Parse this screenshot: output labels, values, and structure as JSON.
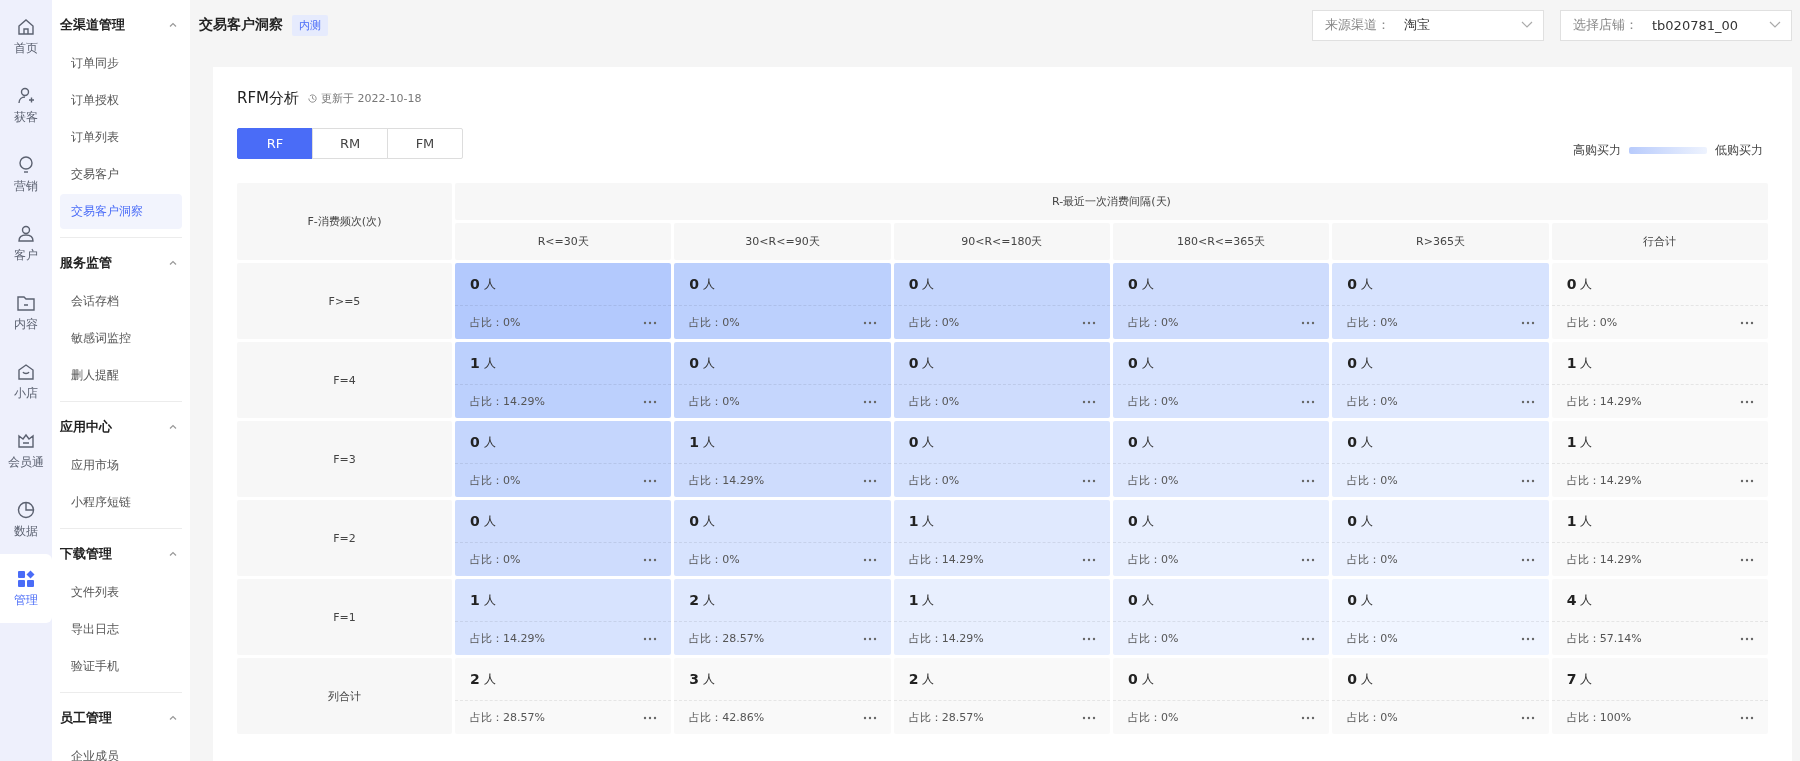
{
  "rail": [
    {
      "label": "首页",
      "selected": false
    },
    {
      "label": "获客",
      "selected": false
    },
    {
      "label": "营销",
      "selected": false
    },
    {
      "label": "客户",
      "selected": false
    },
    {
      "label": "内容",
      "selected": false
    },
    {
      "label": "小店",
      "selected": false
    },
    {
      "label": "会员通",
      "selected": false
    },
    {
      "label": "数据",
      "selected": false
    },
    {
      "label": "管理",
      "selected": true
    }
  ],
  "menu": [
    {
      "title": "全渠道管理",
      "expanded": true,
      "items": [
        {
          "label": "订单同步",
          "selected": false
        },
        {
          "label": "订单授权",
          "selected": false
        },
        {
          "label": "订单列表",
          "selected": false
        },
        {
          "label": "交易客户",
          "selected": false
        },
        {
          "label": "交易客户洞察",
          "selected": true
        }
      ]
    },
    {
      "title": "服务监管",
      "expanded": true,
      "items": [
        {
          "label": "会话存档",
          "selected": false
        },
        {
          "label": "敏感词监控",
          "selected": false
        },
        {
          "label": "删人提醒",
          "selected": false
        }
      ]
    },
    {
      "title": "应用中心",
      "expanded": true,
      "items": [
        {
          "label": "应用市场",
          "selected": false
        },
        {
          "label": "小程序短链",
          "selected": false
        }
      ]
    },
    {
      "title": "下载管理",
      "expanded": true,
      "items": [
        {
          "label": "文件列表",
          "selected": false
        },
        {
          "label": "导出日志",
          "selected": false
        },
        {
          "label": "验证手机",
          "selected": false
        }
      ]
    },
    {
      "title": "员工管理",
      "expanded": true,
      "items": [
        {
          "label": "企业成员",
          "selected": false
        }
      ]
    }
  ],
  "page": {
    "title": "交易客户洞察",
    "badge": "内测"
  },
  "filters": [
    {
      "label": "来源渠道：",
      "value": "淘宝"
    },
    {
      "label": "选择店铺：",
      "value": "tb020781_00"
    }
  ],
  "card": {
    "title": "RFM分析",
    "updated": "更新于 2022-10-18",
    "tabs": [
      {
        "label": "RF",
        "selected": true
      },
      {
        "label": "RM",
        "selected": false
      },
      {
        "label": "FM",
        "selected": false
      }
    ],
    "legend": {
      "high": "高购买力",
      "low": "低购买力"
    },
    "table": {
      "corner": "F-消费频次(次)",
      "group": "R-最近一次消费间隔(天)",
      "columns": [
        "R<=30天",
        "30<R<=90天",
        "90<R<=180天",
        "180<R<=365天",
        "R>365天",
        "行合计"
      ],
      "rows": [
        {
          "label": "F>=5",
          "cells": [
            {
              "count": "0",
              "unit": "人",
              "share": "占比：0%",
              "color": "#b3c9fd"
            },
            {
              "count": "0",
              "unit": "人",
              "share": "占比：0%",
              "color": "#bcd0fd"
            },
            {
              "count": "0",
              "unit": "人",
              "share": "占比：0%",
              "color": "#c5d6fd"
            },
            {
              "count": "0",
              "unit": "人",
              "share": "占比：0%",
              "color": "#cedcfd"
            },
            {
              "count": "0",
              "unit": "人",
              "share": "占比：0%",
              "color": "#d7e3fe"
            },
            {
              "count": "0",
              "unit": "人",
              "share": "占比：0%"
            }
          ]
        },
        {
          "label": "F=4",
          "cells": [
            {
              "count": "1",
              "unit": "人",
              "share": "占比：14.29%",
              "color": "#bcd0fd"
            },
            {
              "count": "0",
              "unit": "人",
              "share": "占比：0%",
              "color": "#c5d6fd"
            },
            {
              "count": "0",
              "unit": "人",
              "share": "占比：0%",
              "color": "#cedcfd"
            },
            {
              "count": "0",
              "unit": "人",
              "share": "占比：0%",
              "color": "#d7e3fe"
            },
            {
              "count": "0",
              "unit": "人",
              "share": "占比：0%",
              "color": "#e0e9fe"
            },
            {
              "count": "1",
              "unit": "人",
              "share": "占比：14.29%"
            }
          ]
        },
        {
          "label": "F=3",
          "cells": [
            {
              "count": "0",
              "unit": "人",
              "share": "占比：0%",
              "color": "#c5d6fd"
            },
            {
              "count": "1",
              "unit": "人",
              "share": "占比：14.29%",
              "color": "#cedcfd"
            },
            {
              "count": "0",
              "unit": "人",
              "share": "占比：0%",
              "color": "#d7e3fe"
            },
            {
              "count": "0",
              "unit": "人",
              "share": "占比：0%",
              "color": "#e0e9fe"
            },
            {
              "count": "0",
              "unit": "人",
              "share": "占比：0%",
              "color": "#e8effe"
            },
            {
              "count": "1",
              "unit": "人",
              "share": "占比：14.29%"
            }
          ]
        },
        {
          "label": "F=2",
          "cells": [
            {
              "count": "0",
              "unit": "人",
              "share": "占比：0%",
              "color": "#cedcfd"
            },
            {
              "count": "0",
              "unit": "人",
              "share": "占比：0%",
              "color": "#d7e3fe"
            },
            {
              "count": "1",
              "unit": "人",
              "share": "占比：14.29%",
              "color": "#e0e9fe"
            },
            {
              "count": "0",
              "unit": "人",
              "share": "占比：0%",
              "color": "#e8effe"
            },
            {
              "count": "0",
              "unit": "人",
              "share": "占比：0%",
              "color": "#eaf0fe"
            },
            {
              "count": "1",
              "unit": "人",
              "share": "占比：14.29%"
            }
          ]
        },
        {
          "label": "F=1",
          "cells": [
            {
              "count": "1",
              "unit": "人",
              "share": "占比：14.29%",
              "color": "#d7e3fe"
            },
            {
              "count": "2",
              "unit": "人",
              "share": "占比：28.57%",
              "color": "#e0e9fe"
            },
            {
              "count": "1",
              "unit": "人",
              "share": "占比：14.29%",
              "color": "#e8effe"
            },
            {
              "count": "0",
              "unit": "人",
              "share": "占比：0%",
              "color": "#eaf0fe"
            },
            {
              "count": "0",
              "unit": "人",
              "share": "占比：0%",
              "color": "#f0f5ff"
            },
            {
              "count": "4",
              "unit": "人",
              "share": "占比：57.14%"
            }
          ]
        },
        {
          "label": "列合计",
          "cells": [
            {
              "count": "2",
              "unit": "人",
              "share": "占比：28.57%"
            },
            {
              "count": "3",
              "unit": "人",
              "share": "占比：42.86%"
            },
            {
              "count": "2",
              "unit": "人",
              "share": "占比：28.57%"
            },
            {
              "count": "0",
              "unit": "人",
              "share": "占比：0%"
            },
            {
              "count": "0",
              "unit": "人",
              "share": "占比：0%"
            },
            {
              "count": "7",
              "unit": "人",
              "share": "占比：100%"
            }
          ]
        }
      ]
    }
  }
}
